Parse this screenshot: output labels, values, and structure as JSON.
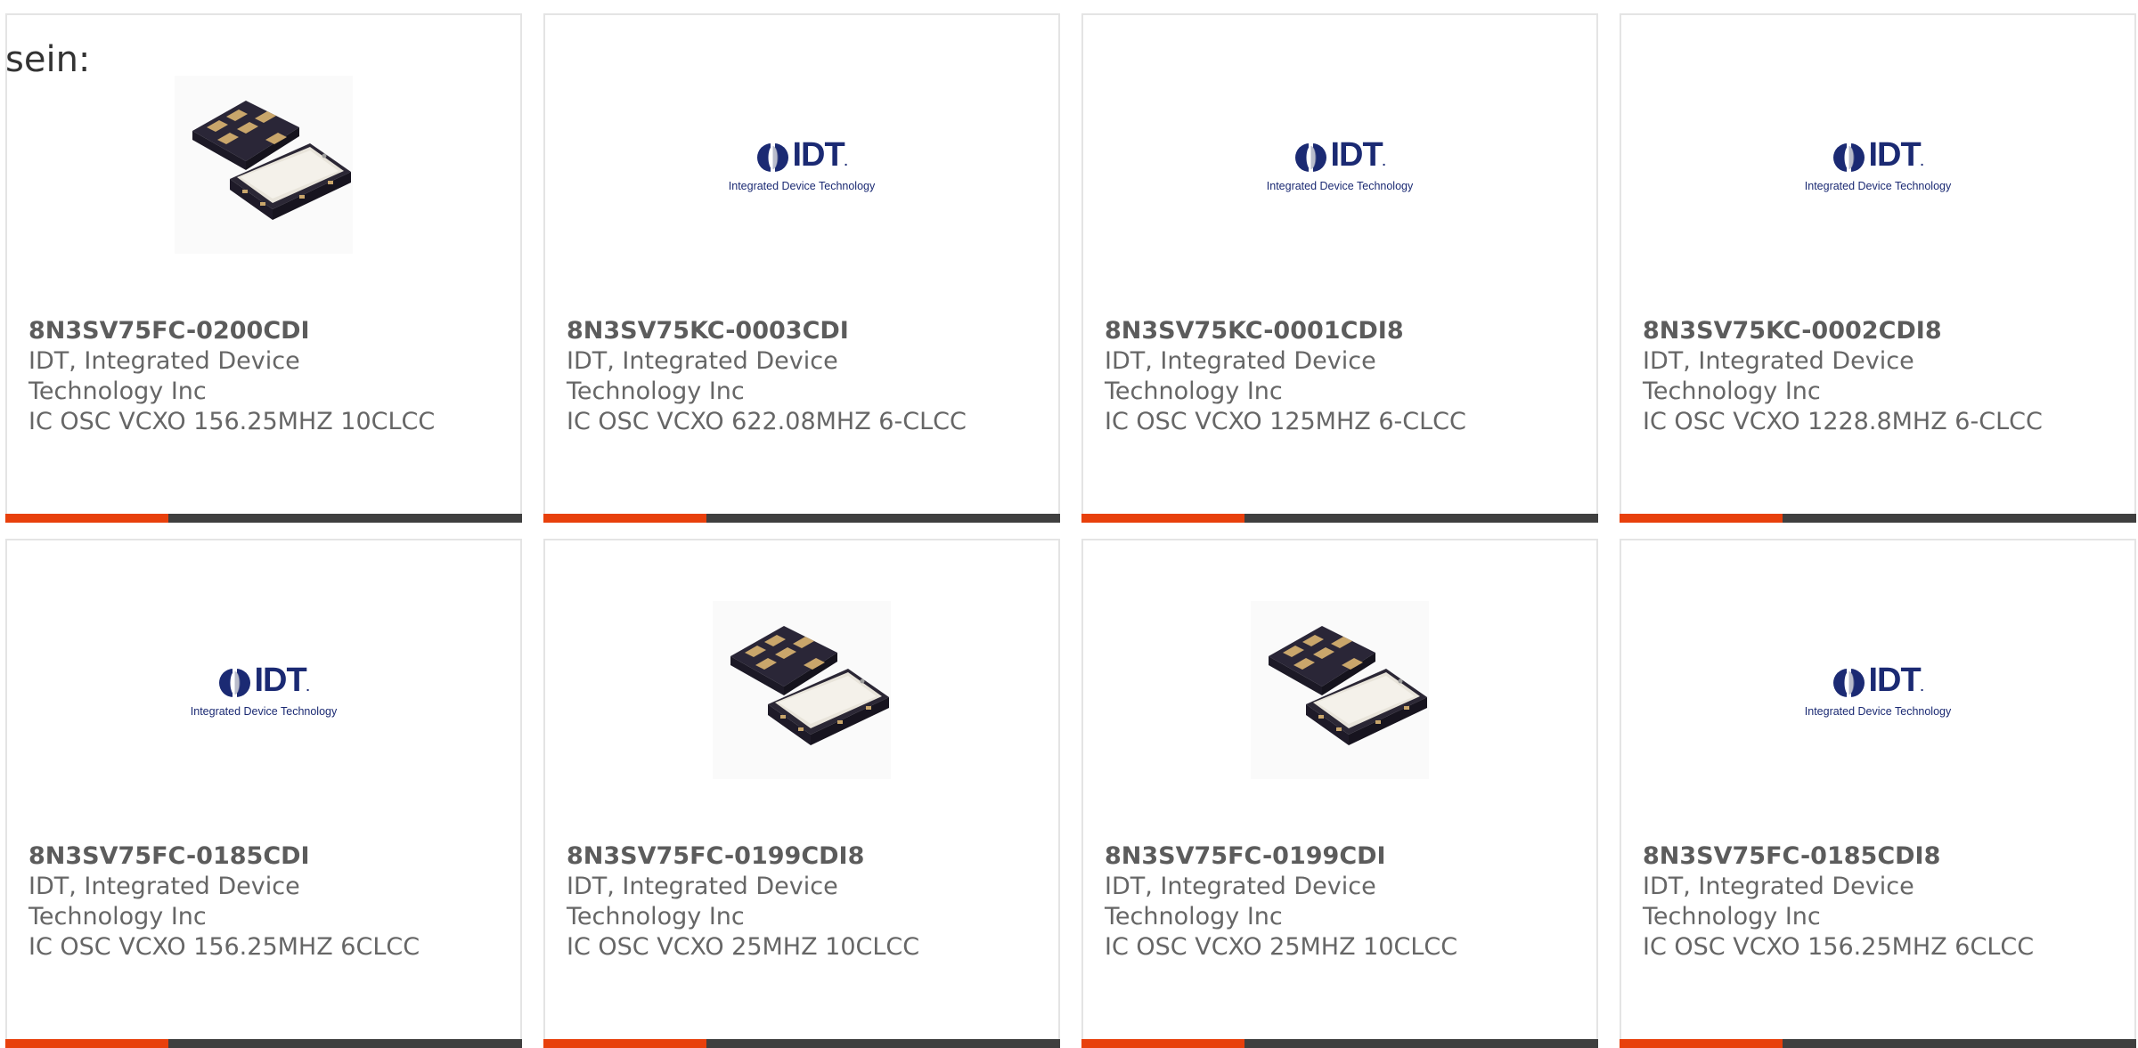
{
  "intro": {
    "text": "sein:"
  },
  "colors": {
    "accent": "#e8400c",
    "bar_dark": "#3f3f3f",
    "logo_blue": "#1b2a73"
  },
  "logo": {
    "word": "IDT",
    "trademark": ".",
    "tagline": "Integrated Device Technology"
  },
  "products": [
    {
      "part_number": "8N3SV75FC-0200CDI",
      "manufacturer_line1": "IDT, Integrated Device",
      "manufacturer_line2": "Technology Inc",
      "description": "IC OSC VCXO 156.25MHZ 10CLCC",
      "image": "oscillator-package-photo"
    },
    {
      "part_number": "8N3SV75KC-0003CDI",
      "manufacturer_line1": "IDT, Integrated Device",
      "manufacturer_line2": "Technology Inc",
      "description": "IC OSC VCXO 622.08MHZ 6-CLCC",
      "image": "idt-logo"
    },
    {
      "part_number": "8N3SV75KC-0001CDI8",
      "manufacturer_line1": "IDT, Integrated Device",
      "manufacturer_line2": "Technology Inc",
      "description": "IC OSC VCXO 125MHZ 6-CLCC",
      "image": "idt-logo"
    },
    {
      "part_number": "8N3SV75KC-0002CDI8",
      "manufacturer_line1": "IDT, Integrated Device",
      "manufacturer_line2": "Technology Inc",
      "description": "IC OSC VCXO 1228.8MHZ 6-CLCC",
      "image": "idt-logo"
    },
    {
      "part_number": "8N3SV75FC-0185CDI",
      "manufacturer_line1": "IDT, Integrated Device",
      "manufacturer_line2": "Technology Inc",
      "description": "IC OSC VCXO 156.25MHZ 6CLCC",
      "image": "idt-logo"
    },
    {
      "part_number": "8N3SV75FC-0199CDI8",
      "manufacturer_line1": "IDT, Integrated Device",
      "manufacturer_line2": "Technology Inc",
      "description": "IC OSC VCXO 25MHZ 10CLCC",
      "image": "oscillator-package-photo"
    },
    {
      "part_number": "8N3SV75FC-0199CDI",
      "manufacturer_line1": "IDT, Integrated Device",
      "manufacturer_line2": "Technology Inc",
      "description": "IC OSC VCXO 25MHZ 10CLCC",
      "image": "oscillator-package-photo"
    },
    {
      "part_number": "8N3SV75FC-0185CDI8",
      "manufacturer_line1": "IDT, Integrated Device",
      "manufacturer_line2": "Technology Inc",
      "description": "IC OSC VCXO 156.25MHZ 6CLCC",
      "image": "idt-logo"
    }
  ]
}
